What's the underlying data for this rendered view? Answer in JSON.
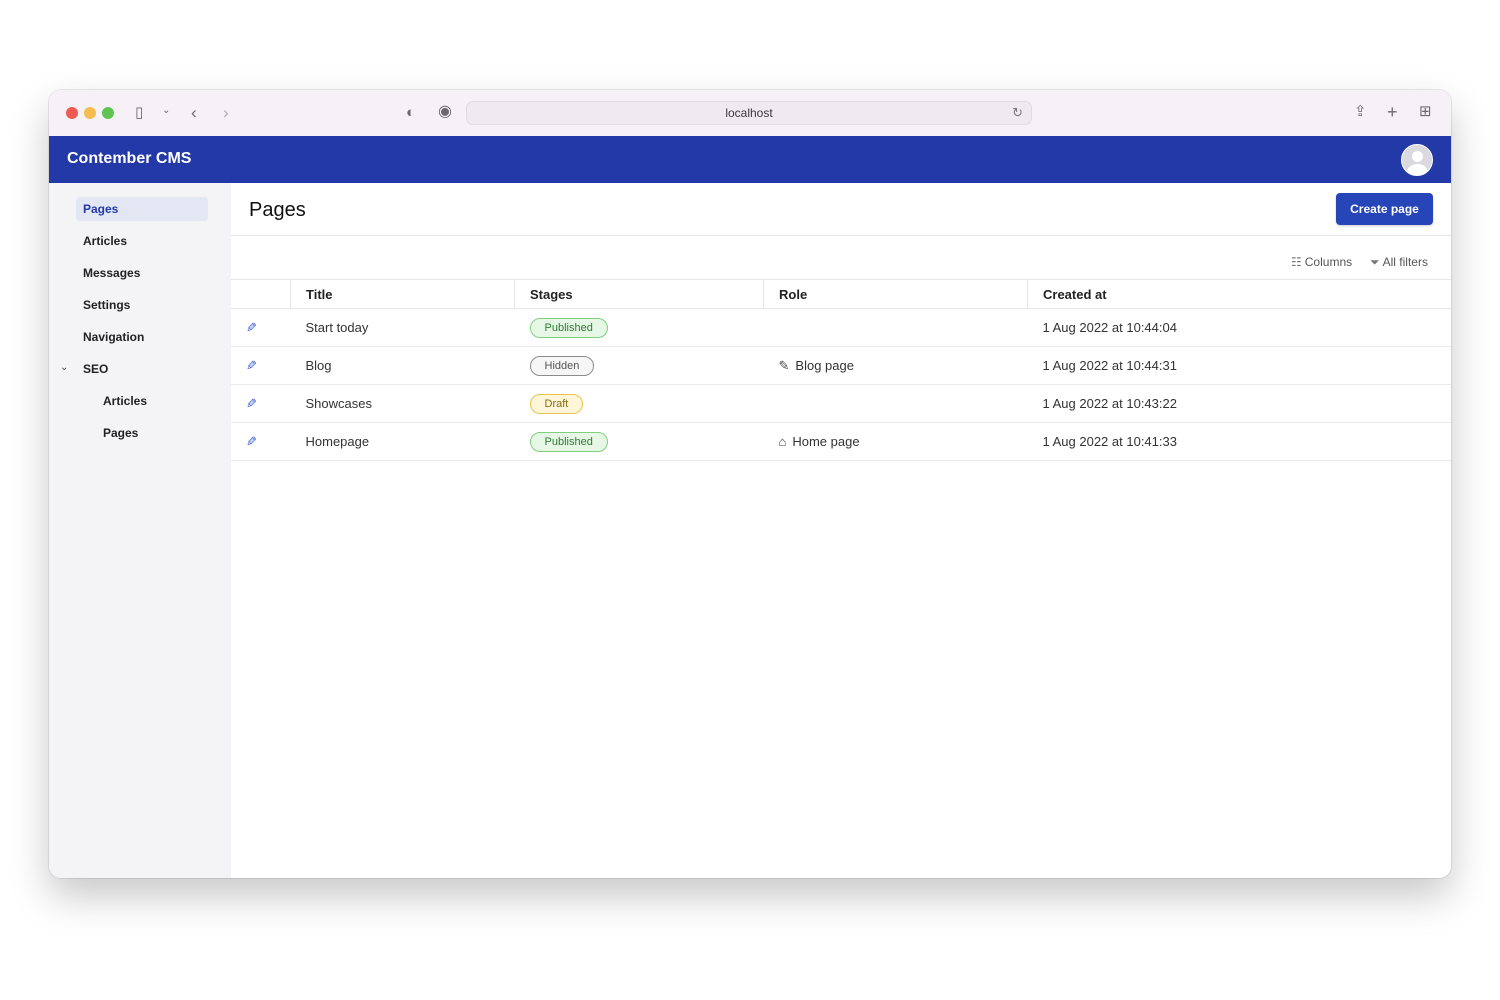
{
  "browser": {
    "url": "localhost"
  },
  "app": {
    "title": "Contember CMS"
  },
  "sidebar": {
    "items": [
      {
        "label": "Pages"
      },
      {
        "label": "Articles"
      },
      {
        "label": "Messages"
      },
      {
        "label": "Settings"
      },
      {
        "label": "Navigation"
      },
      {
        "label": "SEO"
      },
      {
        "label": "Articles"
      },
      {
        "label": "Pages"
      }
    ]
  },
  "main": {
    "title": "Pages",
    "create_button": "Create page",
    "columns_label": "Columns",
    "filters_label": "All filters",
    "table": {
      "headers": [
        "Title",
        "Stages",
        "Role",
        "Created at"
      ],
      "rows": [
        {
          "title": "Start today",
          "stage": "Published",
          "role": "",
          "created": "1 Aug 2022 at 10:44:04"
        },
        {
          "title": "Blog",
          "stage": "Hidden",
          "role": "Blog page",
          "created": "1 Aug 2022 at 10:44:31"
        },
        {
          "title": "Showcases",
          "stage": "Draft",
          "role": "",
          "created": "1 Aug 2022 at 10:43:22"
        },
        {
          "title": "Homepage",
          "stage": "Published",
          "role": "Home page",
          "created": "1 Aug 2022 at 10:41:33"
        }
      ]
    }
  },
  "colors": {
    "header_bg": "#2339a8",
    "primary_button": "#2645b8",
    "published": "#2e7d32",
    "draft": "#8a6a10"
  }
}
